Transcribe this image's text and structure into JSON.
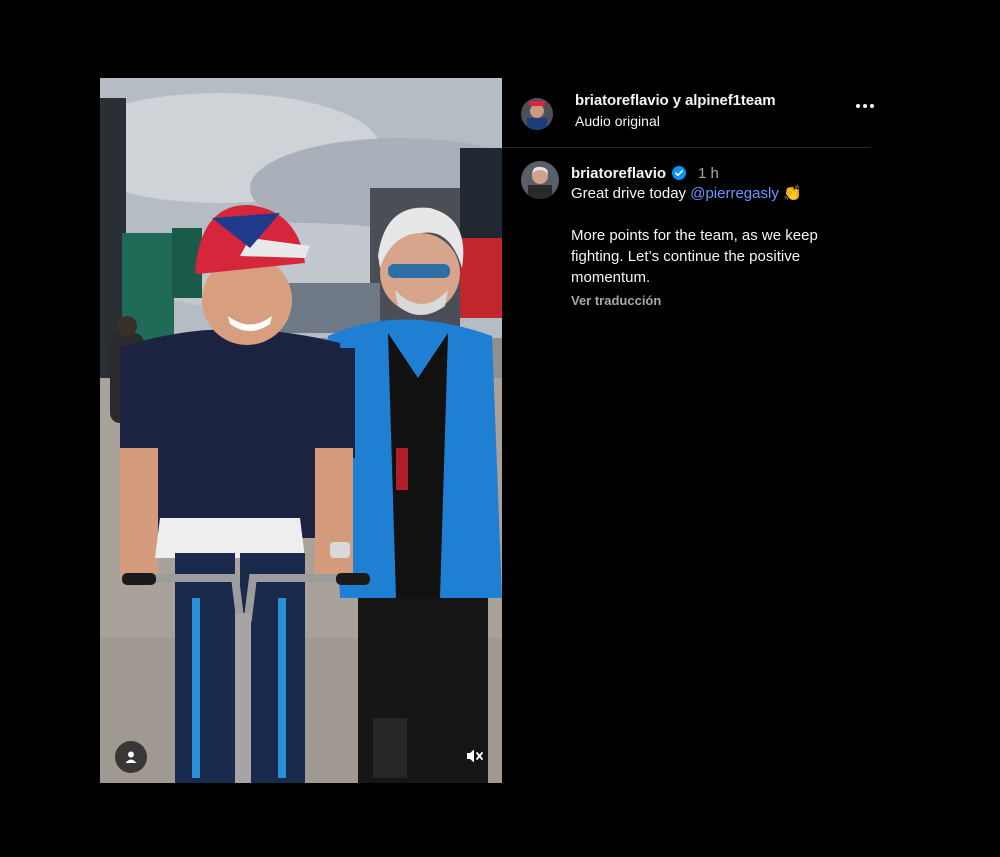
{
  "post": {
    "header": {
      "owners": "briatoreflavio y alpinef1team",
      "audio": "Audio original"
    },
    "caption": {
      "username": "briatoreflavio",
      "time": "1 h",
      "line1_text": "Great drive today ",
      "mention": "@pierregasly",
      "emoji": "👏",
      "paragraph2": "More points for the team, as we keep fighting. Let’s continue the positive momentum.",
      "translate": "Ver traducción"
    }
  },
  "icons": {
    "more": "more-options-icon",
    "verified": "verified-badge-icon",
    "user_tag": "user-tag-icon",
    "mute": "muted-speaker-icon"
  },
  "colors": {
    "background": "#000000",
    "mention": "#6f96ff",
    "verified": "#0095f6",
    "secondary_text": "#a8a8a8",
    "divider": "#262626"
  }
}
